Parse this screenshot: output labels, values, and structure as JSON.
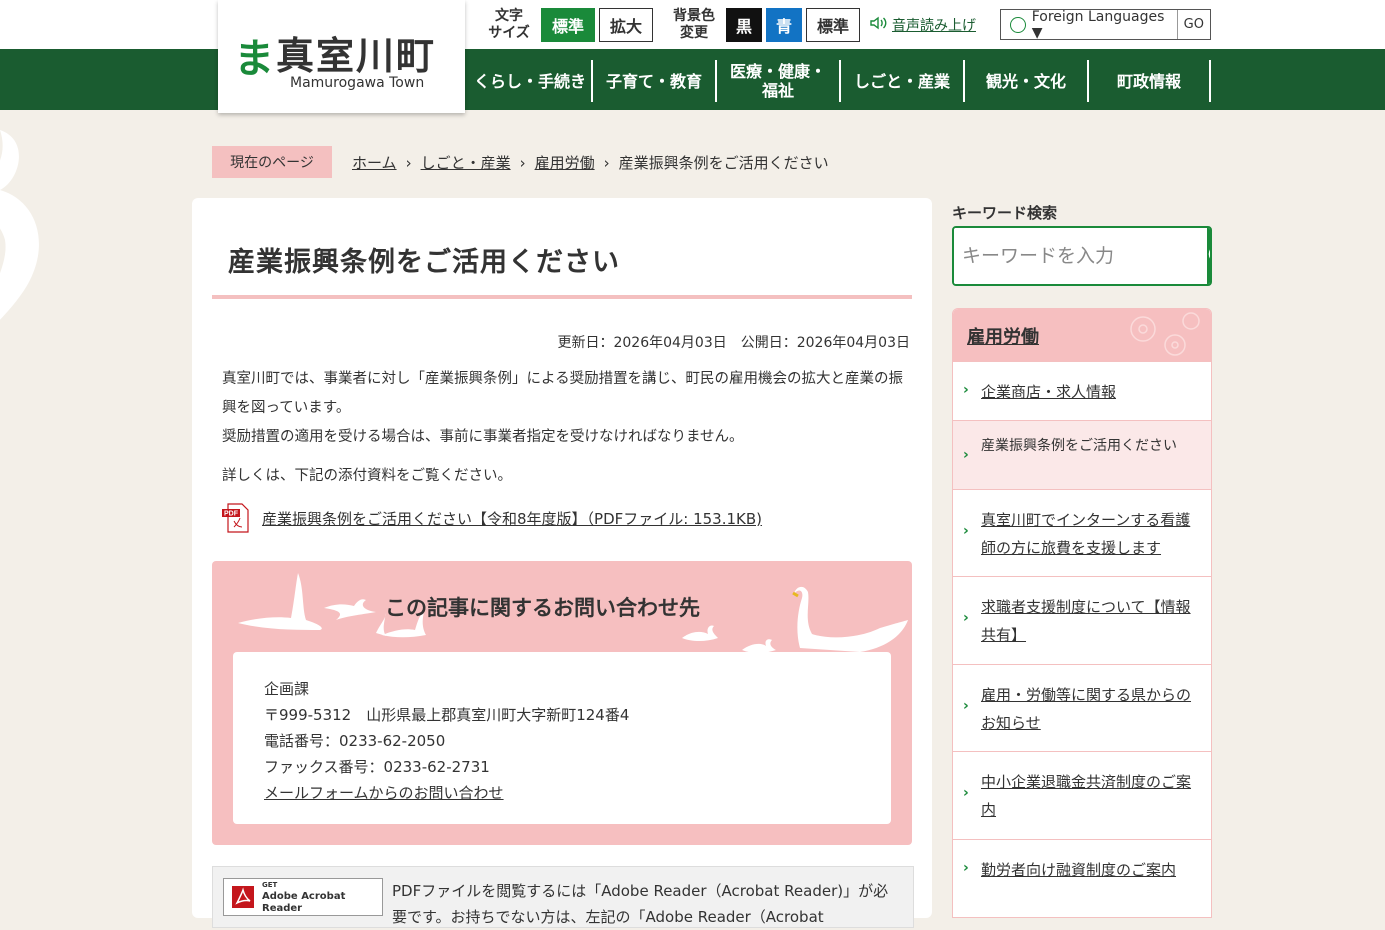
{
  "header": {
    "logo_mark": "ま",
    "logo_name": "真室川町",
    "logo_en": "Mamurogawa Town",
    "text_size_label": "文字\nサイズ",
    "text_size_standard": "標準",
    "text_size_large": "拡大",
    "bg_color_label": "背景色\n変更",
    "bg_black": "黒",
    "bg_blue": "青",
    "bg_standard": "標準",
    "voice": "音声読み上げ",
    "language": "Foreign Languages ▼",
    "go": "GO"
  },
  "nav": {
    "items": [
      "くらし・手続き",
      "子育て・教育",
      "医療・健康・\n福祉",
      "しごと・産業",
      "観光・文化",
      "町政情報"
    ]
  },
  "breadcrumb": {
    "label": "現在のページ",
    "home": "ホーム",
    "level1": "しごと・産業",
    "level2": "雇用労働",
    "current": "産業振興条例をご活用ください"
  },
  "article": {
    "title": "産業振興条例をご活用ください",
    "dates": "更新日：2026年04月03日　公開日：2026年04月03日",
    "p1": " 真室川町では、事業者に対し「産業振興条例」による奨励措置を講じ、町民の雇用機会の拡大と産業の振興を図っています。",
    "p2": " 奨励措置の適用を受ける場合は、事前に事業者指定を受けなければなりません。",
    "p3": "詳しくは、下記の添付資料をご覧ください。",
    "pdf_link": "産業振興条例をご活用ください【令和8年度版】（PDFファイル: 153.1KB)"
  },
  "contact": {
    "heading": "この記事に関するお問い合わせ先",
    "dept": "企画課",
    "address": "〒999-5312　山形県最上郡真室川町大字新町124番4",
    "tel": "電話番号：0233-62-2050",
    "fax": "ファックス番号：0233-62-2731",
    "mail": "メールフォームからのお問い合わせ"
  },
  "adobe": {
    "get": "GET",
    "name": "Adobe Acrobat Reader",
    "text": "PDFファイルを閲覧するには「Adobe Reader（Acrobat Reader)」が必要です。お持ちでない方は、左記の「Adobe Reader（Acrobat"
  },
  "sidebar": {
    "keyword_label": "キーワード検索",
    "keyword_placeholder": "キーワードを入力",
    "section_title": "雇用労働",
    "items": [
      "企業商店・求人情報",
      "産業振興条例をご活用ください",
      "真室川町でインターンする看護師の方に旅費を支援します",
      "求職者支援制度について【情報共有】",
      "雇用・労働等に関する県からのお知らせ",
      "中小企業退職金共済制度のご案内",
      "勤労者向け融資制度のご案内"
    ]
  },
  "colors": {
    "brand_green": "#1a5c30",
    "accent_green": "#1a8a3a",
    "pink": "#f6bfc0",
    "blue": "#1273c4"
  }
}
